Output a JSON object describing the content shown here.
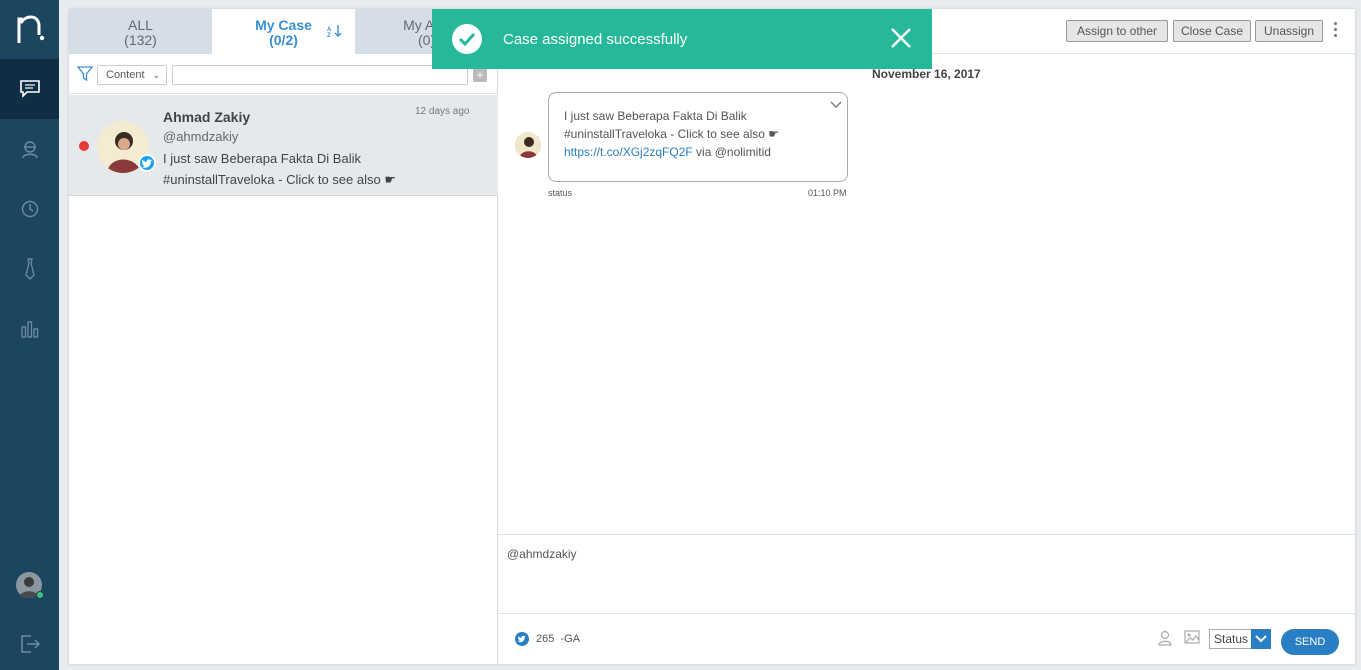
{
  "nav": {
    "logo_icon": "logo-icon",
    "items": [
      {
        "icon": "chat-icon",
        "active": true
      },
      {
        "icon": "agent-icon",
        "active": false
      },
      {
        "icon": "history-icon",
        "active": false
      },
      {
        "icon": "tie-icon",
        "active": false
      },
      {
        "icon": "bar-chart-icon",
        "active": false
      }
    ],
    "logout_icon": "logout-icon"
  },
  "tabs": [
    {
      "label": "ALL",
      "count": "(132)"
    },
    {
      "label": "My Case",
      "count": "(0/2)"
    },
    {
      "label": "My App",
      "count": "(0)"
    }
  ],
  "filter": {
    "select_value": "Content",
    "search_placeholder": ""
  },
  "case_list": [
    {
      "name": "Ahmad Zakiy",
      "handle": "@ahmdzakiy",
      "time": "12 days ago",
      "message": "I just saw Beberapa Fakta Di Balik #uninstallTraveloka - Click to see also ☛"
    }
  ],
  "toolbar": {
    "assign_label": "Assign to other",
    "close_label": "Close Case",
    "unassign_label": "Unassign"
  },
  "conversation": {
    "date": "November 16, 2017",
    "message_line1": "I just saw Beberapa Fakta Di Balik",
    "message_line2": "#uninstallTraveloka - Click to see also ☛",
    "message_link": "https://t.co/XGj2zqFQ2F",
    "message_suffix": " via @nolimitid",
    "type": "status",
    "time": "01:10 PM"
  },
  "reply": {
    "text": "@ahmdzakiy",
    "char_count": "265",
    "account": "-GA",
    "status_value": "Status",
    "send_label": "SEND"
  },
  "toast": {
    "message": "Case assigned successfully"
  },
  "colors": {
    "nav_bg": "#1c4560",
    "accent": "#2a7fc4",
    "toast_bg": "#26b999",
    "unread_dot": "#e83a3a"
  }
}
